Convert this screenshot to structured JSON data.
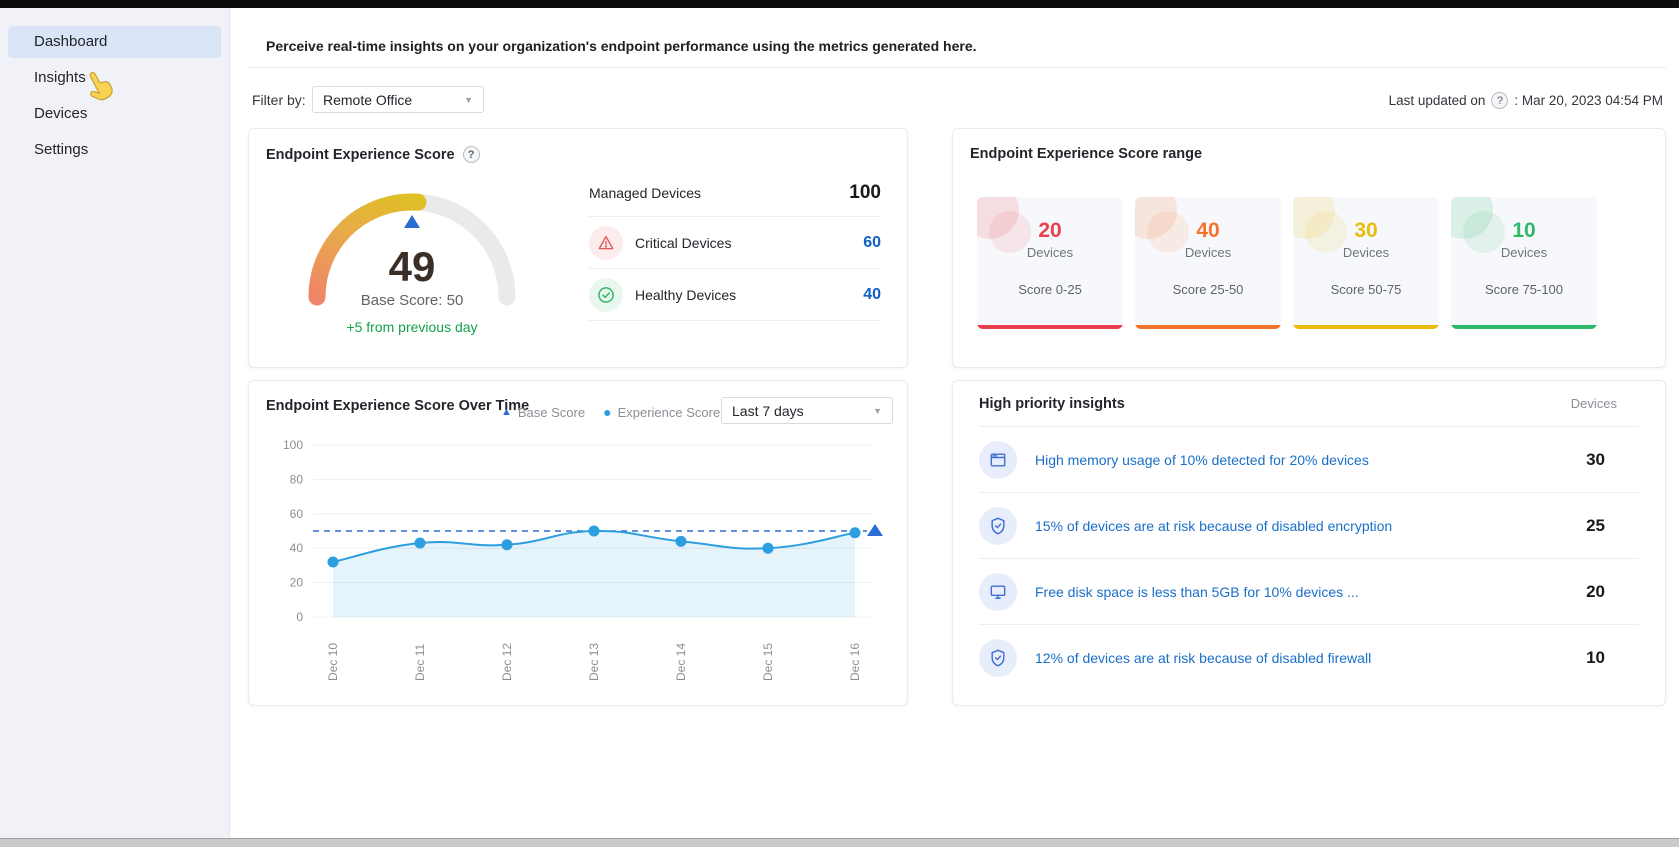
{
  "sidebar": {
    "items": [
      {
        "label": "Dashboard",
        "active": true
      },
      {
        "label": "Insights",
        "active": false
      },
      {
        "label": "Devices",
        "active": false
      },
      {
        "label": "Settings",
        "active": false
      }
    ]
  },
  "header": {
    "description": "Perceive real-time insights on your organization's endpoint performance using the metrics generated here.",
    "filter_label": "Filter by:",
    "filter_value": "Remote Office",
    "last_updated_label": "Last updated on",
    "help_icon": "?",
    "last_updated_value": ": Mar 20, 2023 04:54 PM"
  },
  "score_card": {
    "title": "Endpoint Experience Score",
    "help_icon": "?",
    "score": 49,
    "max": 100,
    "base_score": 50,
    "base_score_label": "Base Score: 50",
    "delta_label": "+5 from previous day",
    "managed_label": "Managed Devices",
    "managed_value": 100,
    "rows": [
      {
        "icon": "warning-icon",
        "label": "Critical Devices",
        "value": 60
      },
      {
        "icon": "healthy-icon",
        "label": "Healthy Devices",
        "value": 40
      }
    ]
  },
  "range_card": {
    "title": "Endpoint Experience Score range",
    "buckets": [
      {
        "count": 20,
        "label": "Devices",
        "range": "Score 0-25",
        "color": "#e8414d"
      },
      {
        "count": 40,
        "label": "Devices",
        "range": "Score 25-50",
        "color": "#f4742b"
      },
      {
        "count": 30,
        "label": "Devices",
        "range": "Score 50-75",
        "color": "#e7bc0e"
      },
      {
        "count": 10,
        "label": "Devices",
        "range": "Score 75-100",
        "color": "#2eb868"
      }
    ]
  },
  "trend_card": {
    "title": "Endpoint Experience Score Over Time",
    "legend": [
      {
        "label": "Base Score",
        "marker": "triangle"
      },
      {
        "label": "Experience Score",
        "marker": "circle"
      }
    ],
    "period_value": "Last 7 days"
  },
  "chart_data": {
    "type": "line",
    "title": "Endpoint Experience Score Over Time",
    "x": [
      "Dec 10",
      "Dec 11",
      "Dec 12",
      "Dec 13",
      "Dec 14",
      "Dec 15",
      "Dec 16"
    ],
    "series": [
      {
        "name": "Experience Score",
        "values": [
          32,
          43,
          42,
          50,
          44,
          40,
          49
        ],
        "color": "#2d9fe0",
        "style": "smooth-line-area-markers"
      },
      {
        "name": "Base Score",
        "values": [
          50,
          50,
          50,
          50,
          50,
          50,
          50
        ],
        "color": "#2b6bd4",
        "style": "dashed-reference-line"
      }
    ],
    "ylim": [
      0,
      100
    ],
    "yticks": [
      0,
      20,
      40,
      60,
      80,
      100
    ],
    "grid": true,
    "legend_position": "top",
    "area_fill": "rgba(45,159,224,0.12)"
  },
  "insights_card": {
    "title": "High priority insights",
    "devices_header": "Devices",
    "rows": [
      {
        "icon": "memory-window-icon",
        "text": "High memory usage of 10% detected for 20% devices",
        "value": 30
      },
      {
        "icon": "shield-check-icon",
        "text": "15% of devices are at risk because of disabled encryption",
        "value": 25
      },
      {
        "icon": "monitor-icon",
        "text": "Free disk space is less than 5GB for 10% devices ...",
        "value": 20
      },
      {
        "icon": "shield-check-icon",
        "text": "12% of devices are at risk because of disabled firewall",
        "value": 10
      }
    ]
  }
}
